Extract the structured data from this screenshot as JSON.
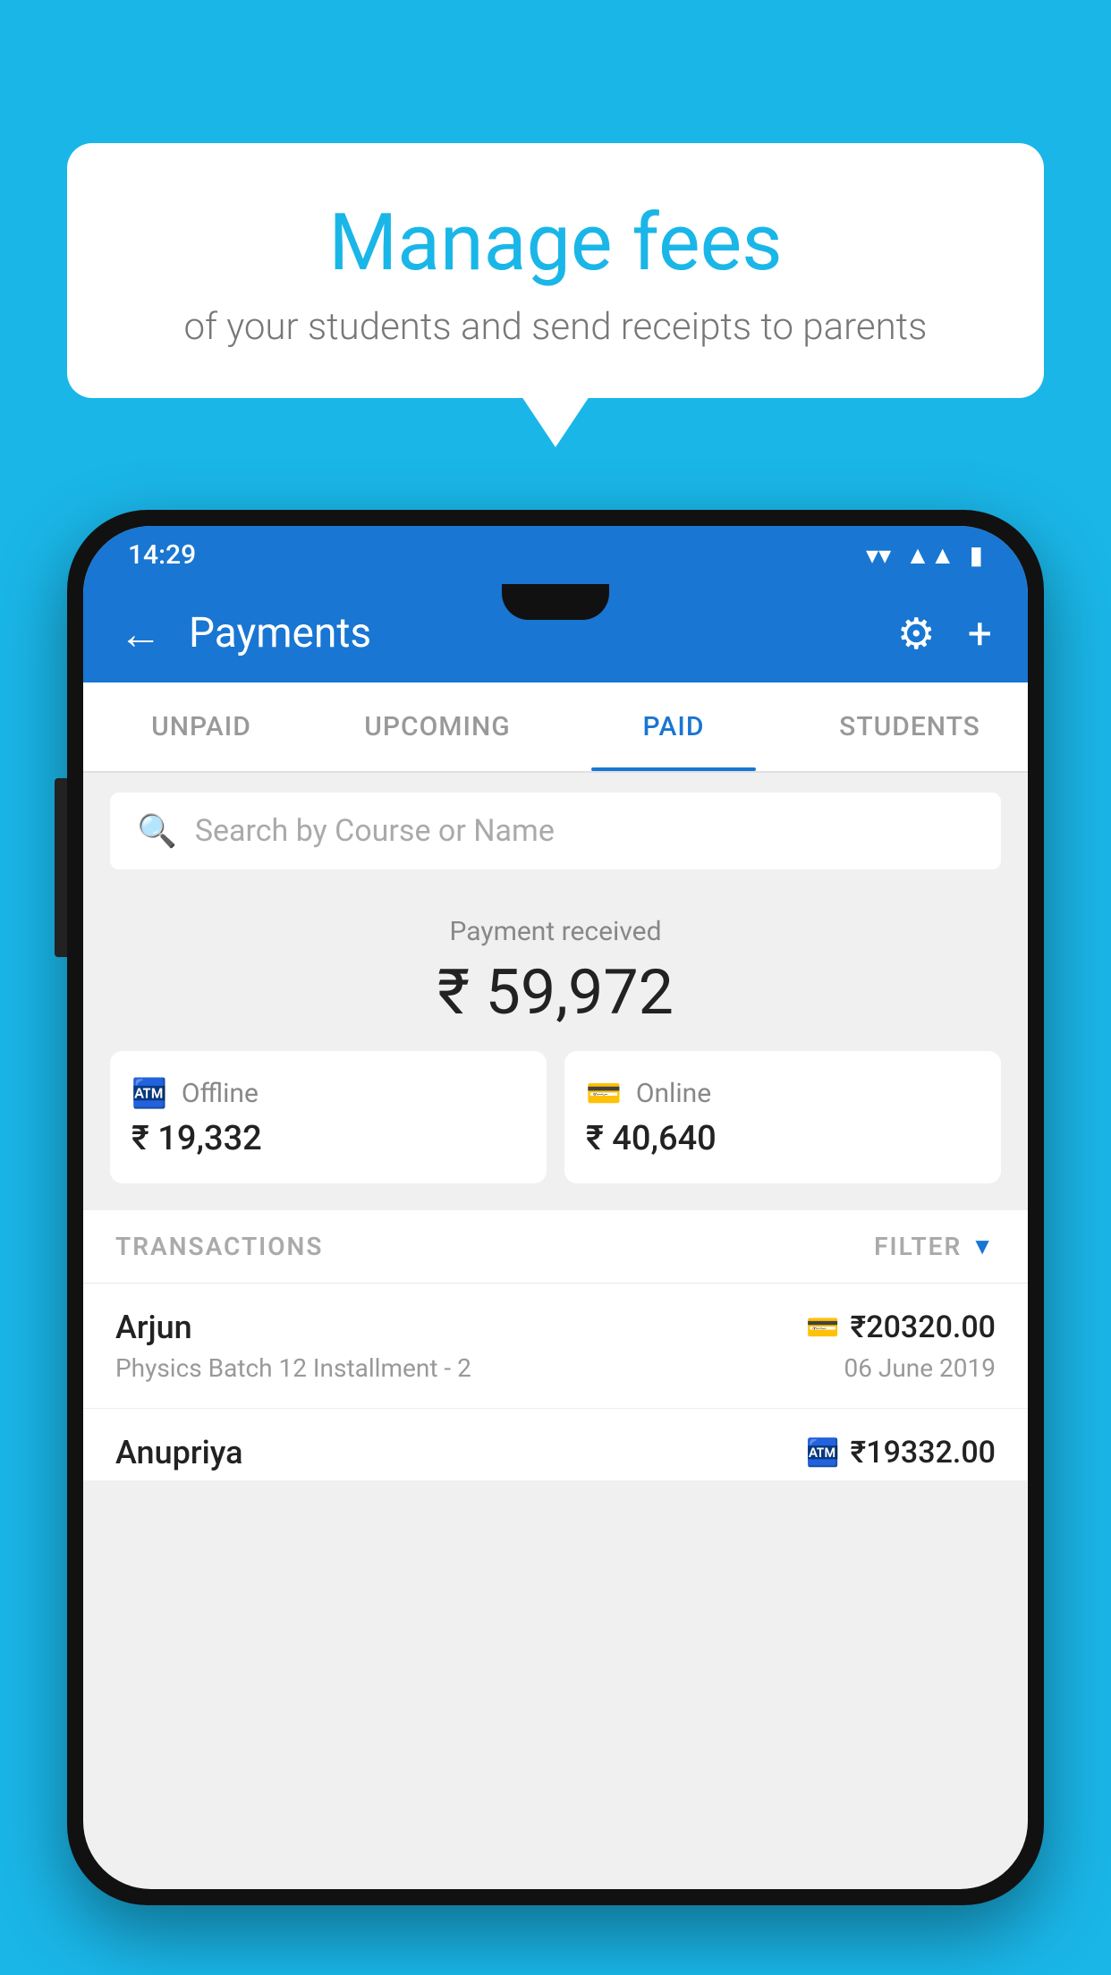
{
  "background_color": "#1ab6e8",
  "speech_bubble": {
    "title": "Manage fees",
    "subtitle": "of your students and send receipts to parents"
  },
  "status_bar": {
    "time": "14:29",
    "wifi": "▼",
    "signal": "▲",
    "battery": "▓"
  },
  "app_bar": {
    "title": "Payments",
    "back_label": "←",
    "gear_label": "⚙",
    "plus_label": "+"
  },
  "tabs": [
    {
      "id": "unpaid",
      "label": "UNPAID",
      "active": false
    },
    {
      "id": "upcoming",
      "label": "UPCOMING",
      "active": false
    },
    {
      "id": "paid",
      "label": "PAID",
      "active": true
    },
    {
      "id": "students",
      "label": "STUDENTS",
      "active": false
    }
  ],
  "search": {
    "placeholder": "Search by Course or Name"
  },
  "payment_summary": {
    "label": "Payment received",
    "amount": "₹ 59,972",
    "offline": {
      "label": "Offline",
      "amount": "₹ 19,332"
    },
    "online": {
      "label": "Online",
      "amount": "₹ 40,640"
    }
  },
  "transactions": {
    "header_label": "TRANSACTIONS",
    "filter_label": "FILTER",
    "rows": [
      {
        "name": "Arjun",
        "amount": "₹20320.00",
        "course": "Physics Batch 12 Installment - 2",
        "date": "06 June 2019",
        "payment_type": "online"
      },
      {
        "name": "Anupriya",
        "amount": "₹19332.00",
        "payment_type": "offline"
      }
    ]
  }
}
